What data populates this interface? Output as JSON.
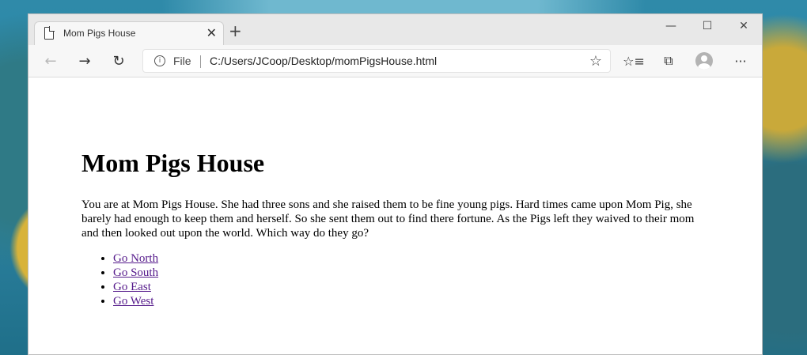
{
  "browser": {
    "tab_title": "Mom Pigs House",
    "address_prefix": "File",
    "url": "C:/Users/JCoop/Desktop/momPigsHouse.html"
  },
  "page": {
    "heading": "Mom Pigs House",
    "paragraph": "You are at Mom Pigs House. She had three sons and she raised them to be fine young pigs. Hard times came upon Mom Pig, she barely had enough to keep them and herself. So she sent them out to find there fortune. As the Pigs left they waived to their mom and then looked out upon the world. Which way do they go?",
    "links": [
      "Go North",
      "Go South",
      "Go East",
      "Go West"
    ]
  }
}
